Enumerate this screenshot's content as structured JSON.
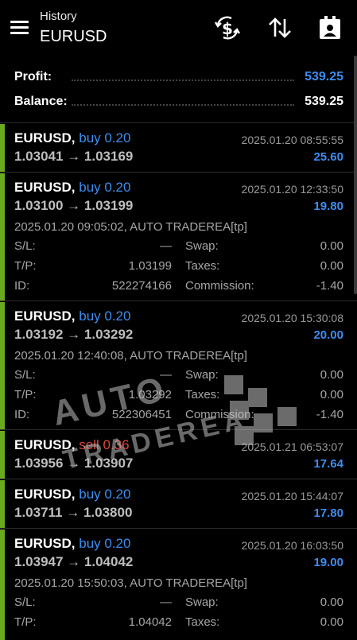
{
  "header": {
    "subtitle": "History",
    "title": "EURUSD",
    "icons": [
      "menu-icon",
      "currency-exchange-icon",
      "sort-icon",
      "report-icon"
    ]
  },
  "summary": {
    "profit_label": "Profit:",
    "profit_value": "539.25",
    "balance_label": "Balance:",
    "balance_value": "539.25"
  },
  "colors": {
    "buy": "#3d8df0",
    "sell": "#e0463d",
    "profit": "#3d8df0",
    "accent_bar": "#6aaa1e",
    "background": "#000000"
  },
  "labels": {
    "sl": "S/L:",
    "tp": "T/P:",
    "id": "ID:",
    "swap": "Swap:",
    "taxes": "Taxes:",
    "commission": "Commission:"
  },
  "deals": [
    {
      "symbol": "EURUSD,",
      "side": "buy 0.20",
      "side_type": "buy",
      "time": "2025.01.20 08:55:55",
      "prices": "1.03041 → 1.03169",
      "profit": "25.60"
    },
    {
      "symbol": "EURUSD,",
      "side": "buy 0.20",
      "side_type": "buy",
      "time": "2025.01.20 12:33:50",
      "prices": "1.03100 → 1.03199",
      "profit": "19.80",
      "open_info": "2025.01.20 09:05:02, AUTO TRADEREA[tp]",
      "sl": "—",
      "tp": "1.03199",
      "id": "522274166",
      "swap": "0.00",
      "taxes": "0.00",
      "commission": "-1.40"
    },
    {
      "symbol": "EURUSD,",
      "side": "buy 0.20",
      "side_type": "buy",
      "time": "2025.01.20 15:30:08",
      "prices": "1.03192 → 1.03292",
      "profit": "20.00",
      "open_info": "2025.01.20 12:40:08, AUTO TRADEREA[tp]",
      "sl": "—",
      "tp": "1.03292",
      "id": "522306451",
      "swap": "0.00",
      "taxes": "0.00",
      "commission": "-1.40"
    },
    {
      "symbol": "EURUSD,",
      "side": "sell 0.36",
      "side_type": "sell",
      "time": "2025.01.21 06:53:07",
      "prices": "1.03956 → 1.03907",
      "profit": "17.64"
    },
    {
      "symbol": "EURUSD,",
      "side": "buy 0.20",
      "side_type": "buy",
      "time": "2025.01.20 15:44:07",
      "prices": "1.03711 → 1.03800",
      "profit": "17.80"
    },
    {
      "symbol": "EURUSD,",
      "side": "buy 0.20",
      "side_type": "buy",
      "time": "2025.01.20 16:03:50",
      "prices": "1.03947 → 1.04042",
      "profit": "19.00",
      "open_info": "2025.01.20 15:50:03, AUTO TRADEREA[tp]",
      "sl": "—",
      "tp": "1.04042",
      "swap": "0.00",
      "taxes": "0.00"
    }
  ],
  "watermark": {
    "line1": "AUTO",
    "line2": "TRADEREA"
  }
}
